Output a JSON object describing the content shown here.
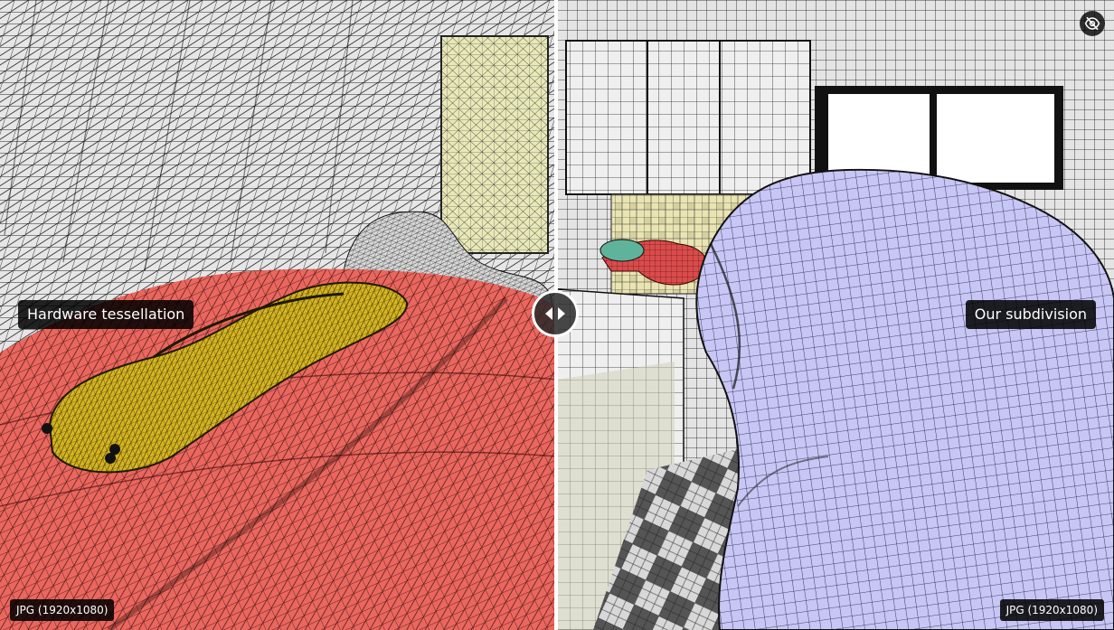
{
  "labels": {
    "left": "Hardware tessellation",
    "right": "Our subdivision"
  },
  "formats": {
    "left": "JPG (1920x1080)",
    "right": "JPG (1920x1080)"
  },
  "icons": {
    "slider_handle": "left-right-arrows-icon",
    "visibility_toggle": "eye-slash-icon"
  },
  "colors": {
    "car_body": "#e9675f",
    "car_model": "#d6b622",
    "cabinet": "#e8e8b8",
    "character": "#c8c6f4",
    "hand": "#d94c4c",
    "wire": "#000000",
    "panel_bg": "#dcdcdc"
  }
}
